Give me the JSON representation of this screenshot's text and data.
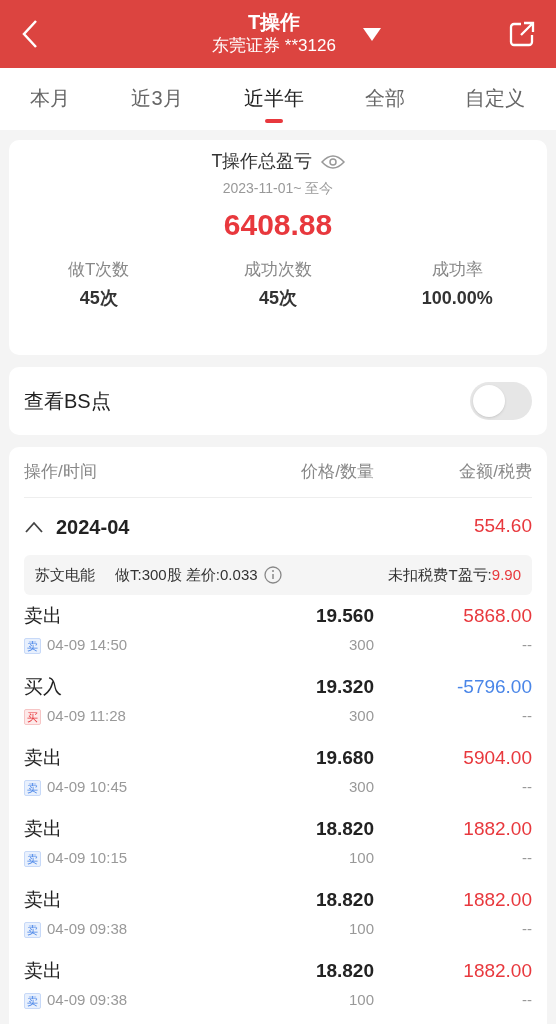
{
  "header": {
    "title": "T操作",
    "account": "东莞证券 **3126"
  },
  "tabs": [
    {
      "label": "本月",
      "selected": false
    },
    {
      "label": "近3月",
      "selected": false
    },
    {
      "label": "近半年",
      "selected": true
    },
    {
      "label": "全部",
      "selected": false
    },
    {
      "label": "自定义",
      "selected": false
    }
  ],
  "summary": {
    "title": "T操作总盈亏",
    "period": "2023-11-01~ 至今",
    "total": "6408.88",
    "stats": [
      {
        "label": "做T次数",
        "value": "45次"
      },
      {
        "label": "成功次数",
        "value": "45次"
      },
      {
        "label": "成功率",
        "value": "100.00%"
      }
    ]
  },
  "bs_points": {
    "label": "查看BS点",
    "on": false
  },
  "table": {
    "columns": [
      "操作/时间",
      "价格/数量",
      "金额/税费"
    ],
    "group": {
      "month": "2024-04",
      "expanded": true,
      "amount": "554.60"
    },
    "stock": {
      "name": "苏文电能",
      "detail": "做T:300股 差价:0.033",
      "profit_label": "未扣税费T盈亏:",
      "profit": "9.90"
    },
    "rows": [
      {
        "kind": "sell",
        "action": "卖出",
        "badge": "卖",
        "time": "04-09 14:50",
        "price": "19.560",
        "qty": "300",
        "amount": "5868.00",
        "fee": "--"
      },
      {
        "kind": "buy",
        "action": "买入",
        "badge": "买",
        "time": "04-09 11:28",
        "price": "19.320",
        "qty": "300",
        "amount": "-5796.00",
        "fee": "--"
      },
      {
        "kind": "sell",
        "action": "卖出",
        "badge": "卖",
        "time": "04-09 10:45",
        "price": "19.680",
        "qty": "300",
        "amount": "5904.00",
        "fee": "--"
      },
      {
        "kind": "sell",
        "action": "卖出",
        "badge": "卖",
        "time": "04-09 10:15",
        "price": "18.820",
        "qty": "100",
        "amount": "1882.00",
        "fee": "--"
      },
      {
        "kind": "sell",
        "action": "卖出",
        "badge": "卖",
        "time": "04-09 09:38",
        "price": "18.820",
        "qty": "100",
        "amount": "1882.00",
        "fee": "--"
      },
      {
        "kind": "sell",
        "action": "卖出",
        "badge": "卖",
        "time": "04-09 09:38",
        "price": "18.820",
        "qty": "100",
        "amount": "1882.00",
        "fee": "--"
      }
    ]
  }
}
